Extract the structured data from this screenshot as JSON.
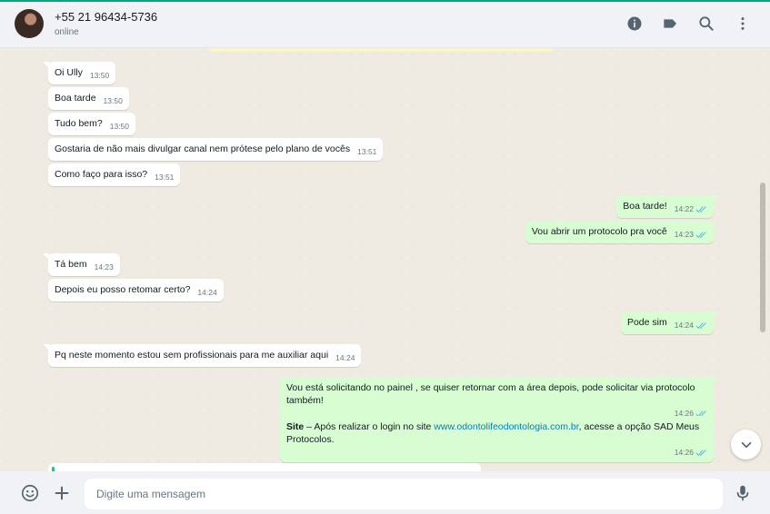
{
  "header": {
    "contact_name": "+55 21 96434-5736",
    "status": "online",
    "icons": [
      "info-icon",
      "label-icon",
      "search-icon",
      "menu-icon"
    ]
  },
  "messages": [
    {
      "id": "m1",
      "direction": "in",
      "text": "Oi Ully",
      "time": "13:50"
    },
    {
      "id": "m2",
      "direction": "in",
      "text": "Boa tarde",
      "time": "13:50"
    },
    {
      "id": "m3",
      "direction": "in",
      "text": "Tudo bem?",
      "time": "13:50"
    },
    {
      "id": "m4",
      "direction": "in",
      "text": "Gostaria de não mais divulgar canal nem prótese pelo plano de vocês",
      "time": "13:51"
    },
    {
      "id": "m5",
      "direction": "in",
      "text": "Como faço para isso?",
      "time": "13:51"
    },
    {
      "id": "m6",
      "direction": "out",
      "text": "Boa tarde!",
      "time": "14:22",
      "status": "read"
    },
    {
      "id": "m7",
      "direction": "out",
      "text": "Vou abrir um protocolo pra você",
      "time": "14:23",
      "status": "read"
    },
    {
      "id": "m8",
      "direction": "in",
      "text": "Tá bem",
      "time": "14:23"
    },
    {
      "id": "m9",
      "direction": "in",
      "text": "Depois eu posso retomar certo?",
      "time": "14:24"
    },
    {
      "id": "m10",
      "direction": "out",
      "text": "Pode sim",
      "time": "14:24",
      "status": "read"
    },
    {
      "id": "m11",
      "direction": "in",
      "text": "Pq neste momento estou sem profissionais para me auxiliar aqui",
      "time": "14:24"
    },
    {
      "id": "m12",
      "direction": "out",
      "text": "Vou está solicitando no painel , se quiser retornar com a área depois, pode solicitar via protocolo também!",
      "time": "14:26",
      "status": "read"
    },
    {
      "id": "m13",
      "direction": "out",
      "bold_prefix": "Site",
      "text_before_link": " – Após realizar o login no site ",
      "link": "www.odontolifeodontologia.com.br",
      "text_after_link": ", acesse a opção SAD Meus Protocolos.",
      "time": "14:26",
      "status": "read"
    }
  ],
  "composer": {
    "placeholder": "Digite uma mensagem",
    "value": ""
  },
  "colors": {
    "accent": "#00a884",
    "incoming_bubble": "#ffffff",
    "outgoing_bubble": "#d9fdd3",
    "read_ticks": "#53bdeb",
    "link": "#027eb5",
    "chat_background": "#efeae2"
  }
}
